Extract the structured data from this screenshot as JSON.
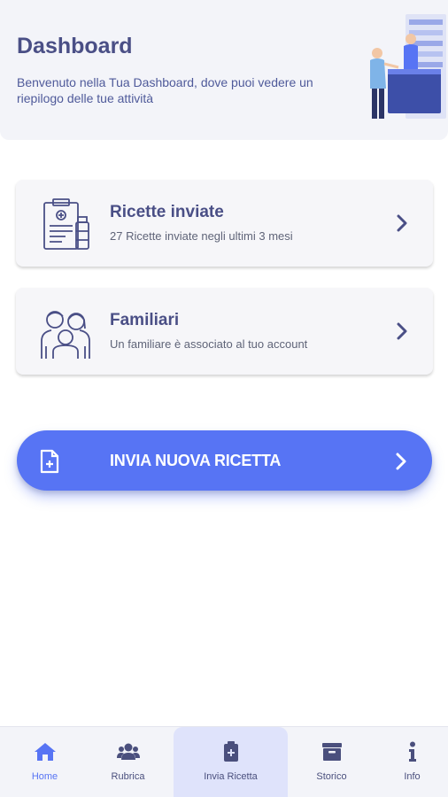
{
  "header": {
    "title": "Dashboard",
    "subtitle": "Benvenuto nella Tua Dashboard, dove puoi vedere un riepilogo delle tue attività",
    "illustration_icon": "pharmacy-illustration"
  },
  "cards": [
    {
      "title": "Ricette inviate",
      "description": "27 Ricette inviate negli ultimi 3 mesi",
      "icon": "prescription-clipboard-icon"
    },
    {
      "title": "Familiari",
      "description": "Un familiare è associato al tuo account",
      "icon": "family-icon"
    }
  ],
  "cta": {
    "label": "INVIA NUOVA RICETTA",
    "icon": "file-medical-icon",
    "color": "#5774f4"
  },
  "bottom_nav": {
    "items": [
      {
        "label": "Home",
        "icon": "home-icon",
        "active": true
      },
      {
        "label": "Rubrica",
        "icon": "users-icon",
        "active": false
      },
      {
        "label": "Invia Ricetta",
        "icon": "clipboard-medical-icon",
        "active": false,
        "highlighted": true
      },
      {
        "label": "Storico",
        "icon": "archive-icon",
        "active": false
      },
      {
        "label": "Info",
        "icon": "info-icon",
        "active": false
      }
    ],
    "active_color": "#5774f4",
    "highlight_color": "#dfe3fb"
  }
}
